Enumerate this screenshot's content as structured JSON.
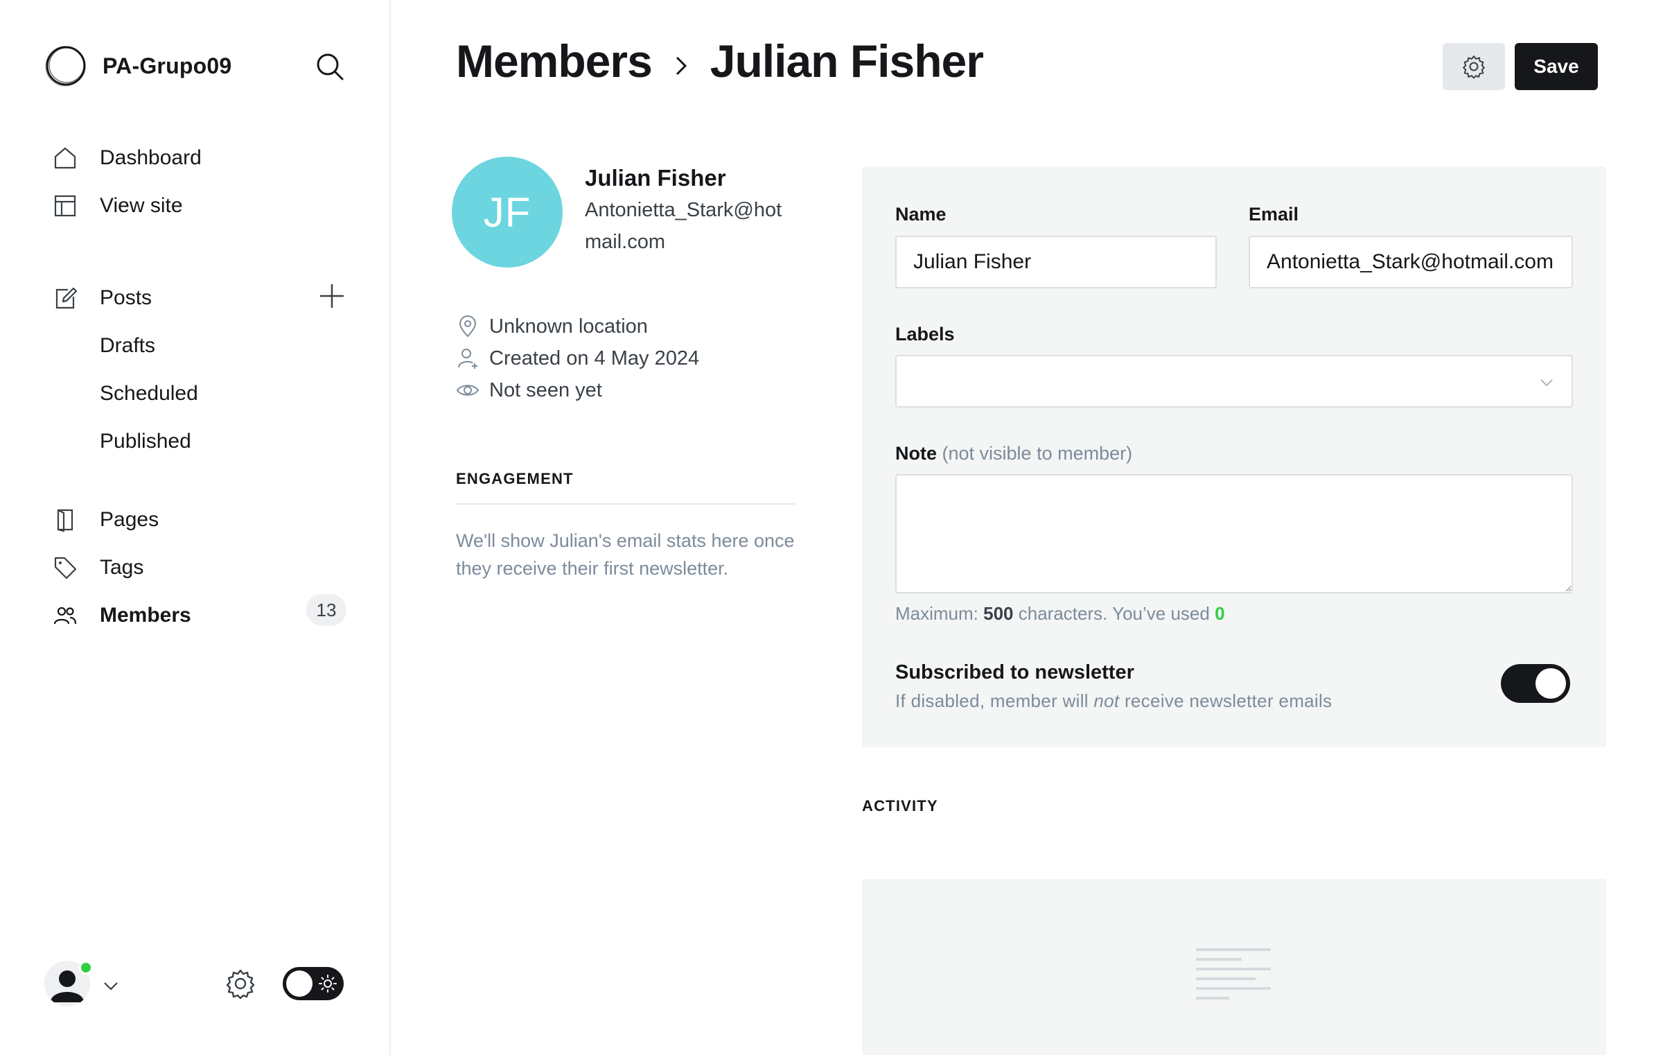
{
  "app": {
    "site_name": "PA-Grupo09"
  },
  "sidebar": {
    "items": [
      {
        "label": "Dashboard",
        "icon": "home-icon"
      },
      {
        "label": "View site",
        "icon": "layout-icon"
      },
      {
        "label": "Posts",
        "icon": "edit-icon"
      },
      {
        "label": "Drafts"
      },
      {
        "label": "Scheduled"
      },
      {
        "label": "Published"
      },
      {
        "label": "Pages",
        "icon": "page-icon"
      },
      {
        "label": "Tags",
        "icon": "tag-icon"
      },
      {
        "label": "Members",
        "icon": "members-icon",
        "count": "13",
        "active": true
      }
    ]
  },
  "header": {
    "breadcrumb_parent": "Members",
    "breadcrumb_current": "Julian Fisher",
    "save_label": "Save"
  },
  "profile": {
    "initials": "JF",
    "name": "Julian Fisher",
    "email": "Antonietta_Stark@hotmail.com",
    "avatar_color": "#6cd5e0",
    "location": "Unknown location",
    "created": "Created on 4 May 2024",
    "last_seen": "Not seen yet"
  },
  "engagement": {
    "heading": "ENGAGEMENT",
    "text": "We'll show Julian's email stats here once they receive their first newsletter."
  },
  "form": {
    "name_label": "Name",
    "name_value": "Julian Fisher",
    "email_label": "Email",
    "email_value": "Antonietta_Stark@hotmail.com",
    "labels_label": "Labels",
    "note_label": "Note",
    "note_sublabel": "(not visible to member)",
    "note_value": "",
    "hint_prefix": "Maximum:",
    "hint_max": "500",
    "hint_middle": "characters. You’ve used",
    "hint_used": "0",
    "newsletter_title": "Subscribed to newsletter",
    "newsletter_desc_before": "If disabled, member will",
    "newsletter_desc_emph": "not",
    "newsletter_desc_after": "receive newsletter emails",
    "newsletter_subscribed": true
  },
  "activity": {
    "heading": "ACTIVITY"
  },
  "colors": {
    "accent_dark": "#15171a",
    "online": "#30cf43",
    "panel_bg": "#f4f5f5"
  }
}
